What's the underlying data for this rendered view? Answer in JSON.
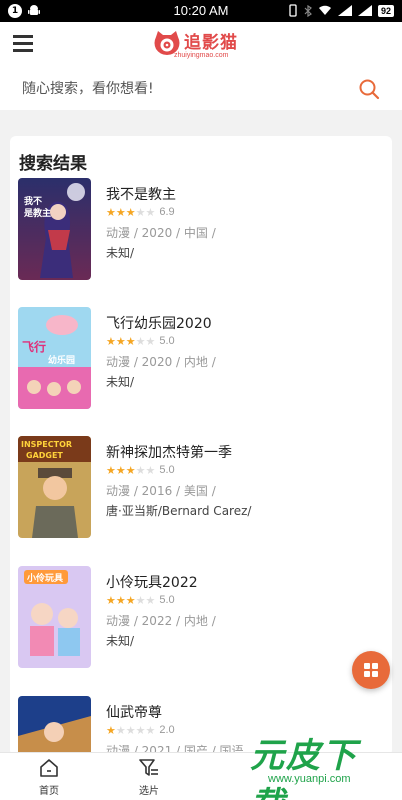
{
  "status_bar": {
    "notification_badge": "1",
    "time": "10:20 AM",
    "battery": "92"
  },
  "header": {
    "logo_text": "追影猫",
    "logo_url": "zhuiyingmao.com",
    "brand_color": "#e14a4a"
  },
  "search": {
    "placeholder": "随心搜索，看你想看!",
    "accent_color": "#e86a3a"
  },
  "results": {
    "title": "搜索结果",
    "items": [
      {
        "title": "我不是教主",
        "stars": 3.5,
        "rating": "6.9",
        "meta": "动漫 / 2020 / 中国 /",
        "people": "未知/"
      },
      {
        "title": "飞行幼乐园2020",
        "stars": 2.5,
        "rating": "5.0",
        "meta": "动漫 / 2020 / 内地 /",
        "people": "未知/"
      },
      {
        "title": "新神探加杰特第一季",
        "stars": 2.5,
        "rating": "5.0",
        "meta": "动漫 / 2016 / 美国 /",
        "people": "唐·亚当斯/Bernard Carez/"
      },
      {
        "title": "小伶玩具2022",
        "stars": 2.5,
        "rating": "5.0",
        "meta": "动漫 / 2022 / 内地 /",
        "people": "未知/"
      },
      {
        "title": "仙武帝尊",
        "stars": 1,
        "rating": "2.0",
        "meta": "动漫 / 2021 / 国产 / 国语",
        "people": ""
      }
    ]
  },
  "bottom_nav": {
    "items": [
      {
        "label": "首页",
        "icon": "home-icon"
      },
      {
        "label": "选片",
        "icon": "filter-icon"
      }
    ]
  },
  "watermark": {
    "text": "元皮下载",
    "url": "www.yuanpi.com"
  }
}
